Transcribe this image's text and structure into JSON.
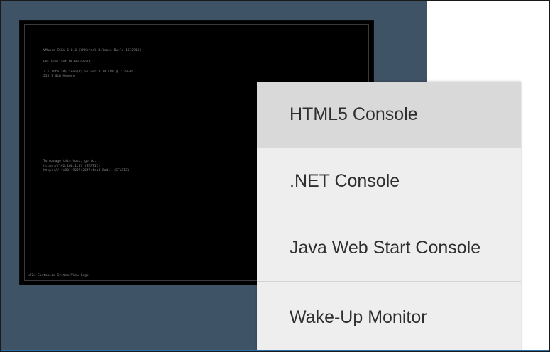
{
  "console": {
    "lines": [
      "VMware ESXi 6.0.0 (VMKernel Release Build 1612919)",
      "HPE ProLiant DL380 Gen10",
      "2 x Intel(R) Xeon(R) Silver 4114 CPU @ 2.20GHz",
      "255.7 GiB Memory",
      "To manage this host, go to:",
      "https://192.168.1.47 (STATIC)",
      "https://[fe80::9267:26ff:fea4:8ad1] (STATIC)",
      "<F2> Customize System/View Logs"
    ]
  },
  "menu": {
    "items": [
      {
        "label": "HTML5 Console",
        "active": true
      },
      {
        "label": ".NET Console",
        "active": false
      },
      {
        "label": "Java Web Start Console",
        "active": false
      },
      {
        "label": "Wake-Up Monitor",
        "active": false
      }
    ]
  },
  "colors": {
    "background_panel": "#3f5366",
    "console_bg": "#000000",
    "menu_bg": "#eeeeee",
    "menu_active_bg": "#d9d9d9",
    "accent_bottom": "#2d6fa8"
  }
}
